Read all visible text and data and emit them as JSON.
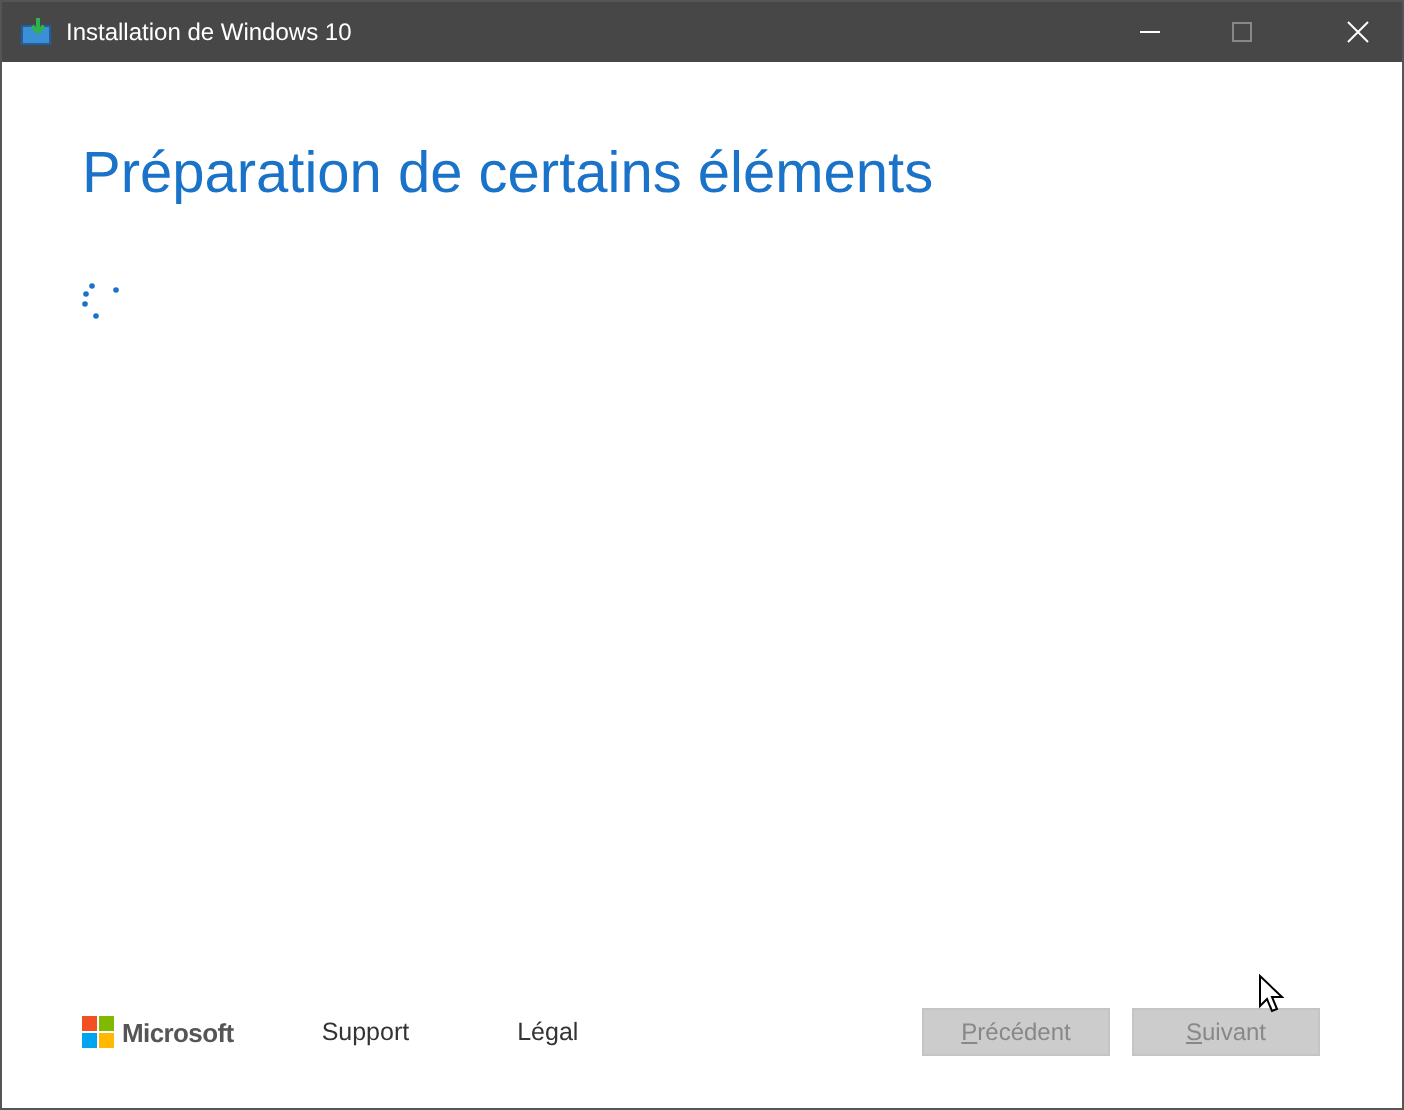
{
  "window": {
    "title": "Installation de Windows 10"
  },
  "heading": "Préparation de certains éléments",
  "footer": {
    "brand": "Microsoft",
    "links": [
      "Support",
      "Légal"
    ]
  },
  "buttons": [
    {
      "label": "Précédent",
      "disabled": true
    },
    {
      "label": "Suivant",
      "disabled": true
    }
  ]
}
